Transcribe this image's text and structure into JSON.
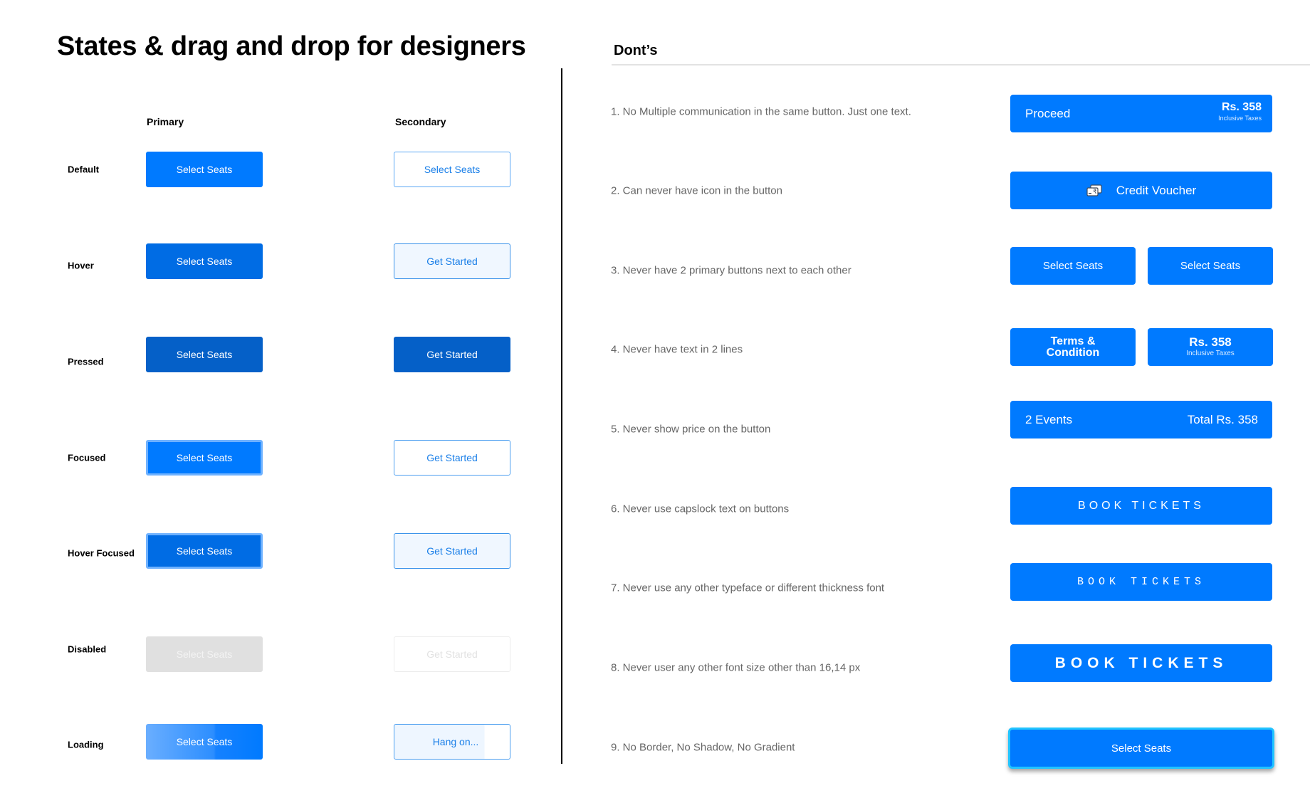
{
  "title": "States & drag and drop for designers",
  "columns": {
    "primary": "Primary",
    "secondary": "Secondary"
  },
  "states": [
    {
      "label": "Default",
      "primary": "Select Seats",
      "secondary": "Select Seats"
    },
    {
      "label": "Hover",
      "primary": "Select Seats",
      "secondary": "Get Started"
    },
    {
      "label": "Pressed",
      "primary": "Select Seats",
      "secondary": "Get Started"
    },
    {
      "label": "Focused",
      "primary": "Select Seats",
      "secondary": "Get Started"
    },
    {
      "label": "Hover Focused",
      "primary": "Select Seats",
      "secondary": "Get Started"
    },
    {
      "label": "Disabled",
      "primary": "Select Seats",
      "secondary": "Get Started"
    },
    {
      "label": "Loading",
      "primary": "Select Seats",
      "secondary": "Hang on..."
    }
  ],
  "colors": {
    "primary": "#007AFF",
    "primary_hover": "#006CE4",
    "primary_pressed": "#0560C8",
    "focus_ring": "#6FB2FF",
    "secondary_hover_bg": "#F0F7FF",
    "disabled_bg": "#E0E0E0"
  },
  "donts": {
    "title": "Dont’s",
    "rules": [
      {
        "text": "1. No Multiple communication in the same button. Just one text.",
        "example": {
          "label": "Proceed",
          "price": "Rs. 358",
          "price_note": "Inclusive Taxes"
        }
      },
      {
        "text": "2. Can never have icon in the button",
        "example": {
          "icon": "rupee-voucher-icon",
          "label": "Credit Voucher"
        }
      },
      {
        "text": "3. Never have 2 primary buttons next to each other",
        "example": {
          "left": "Select Seats",
          "right": "Select Seats"
        }
      },
      {
        "text": "4. Never have text in 2 lines",
        "example": {
          "left_line1": "Terms &",
          "left_line2": "Condition",
          "right_price": "Rs. 358",
          "right_note": "Inclusive Taxes"
        }
      },
      {
        "text": "5. Never show price on the button",
        "example": {
          "left": "2 Events",
          "right": "Total Rs. 358"
        }
      },
      {
        "text": "6. Never use capslock text on buttons",
        "example": {
          "label": "BOOK TICKETS"
        }
      },
      {
        "text": "7. Never use any other typeface or different thickness font",
        "example": {
          "label": "BOOK TICKETS"
        }
      },
      {
        "text": "8. Never user any other font size other than 16,14 px",
        "example": {
          "label": "BOOK TICKETS"
        }
      },
      {
        "text": "9. No Border, No Shadow, No Gradient",
        "example": {
          "label": "Select Seats"
        }
      }
    ]
  }
}
